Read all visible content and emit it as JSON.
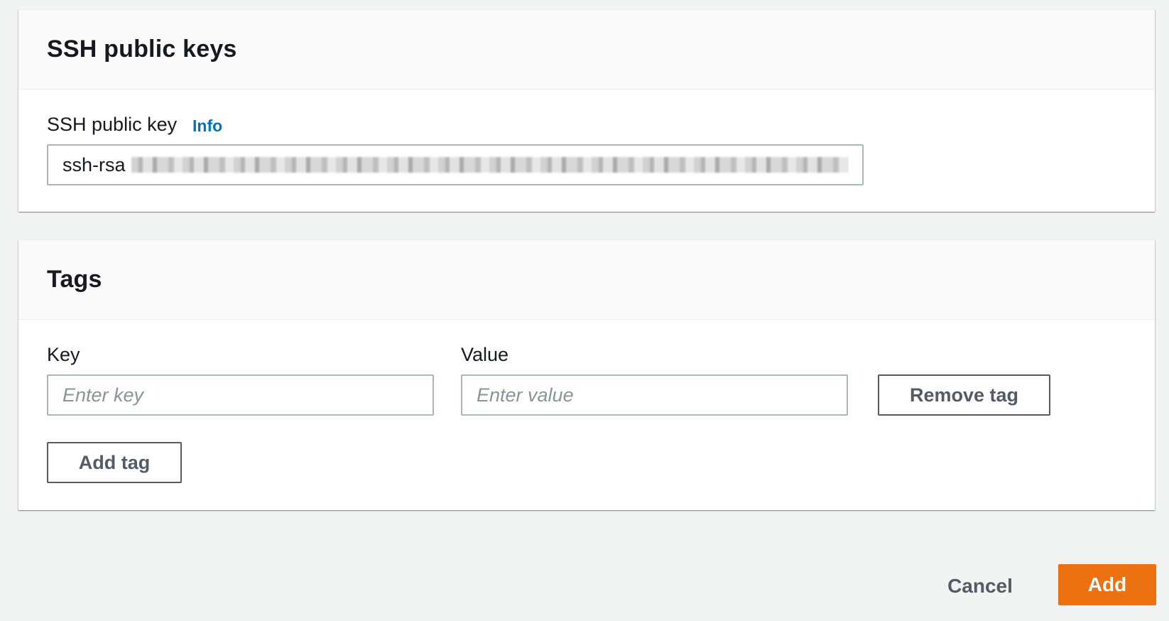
{
  "ssh_panel": {
    "title": "SSH public keys",
    "field_label": "SSH public key",
    "info_link": "Info",
    "value_prefix": "ssh-rsa"
  },
  "tags_panel": {
    "title": "Tags",
    "key_label": "Key",
    "value_label": "Value",
    "key_placeholder": "Enter key",
    "value_placeholder": "Enter value",
    "remove_tag_label": "Remove tag",
    "add_tag_label": "Add tag"
  },
  "footer": {
    "cancel_label": "Cancel",
    "add_label": "Add"
  },
  "colors": {
    "primary": "#ec7211",
    "link": "#0073bb",
    "border": "#aab7b8"
  }
}
